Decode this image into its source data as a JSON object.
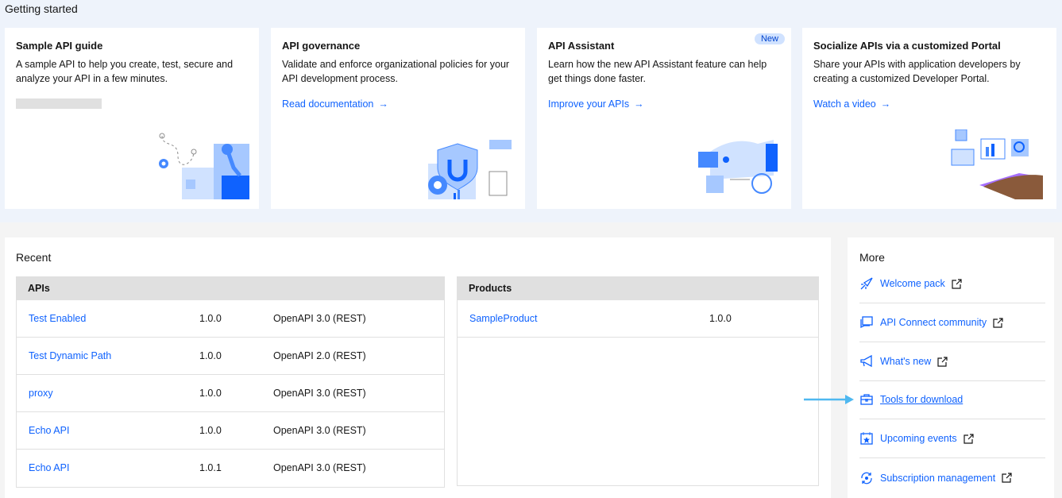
{
  "getting_started": {
    "title": "Getting started",
    "cards": [
      {
        "title": "Sample API guide",
        "description": "A sample API to help you create, test, secure and analyze your API in a few minutes."
      },
      {
        "title": "API governance",
        "description": "Validate and enforce organizational policies for your API development process.",
        "link": "Read documentation"
      },
      {
        "title": "API Assistant",
        "badge": "New",
        "description": "Learn how the new API Assistant feature can help get things done faster.",
        "link": "Improve your APIs"
      },
      {
        "title": "Socialize APIs via a customized Portal",
        "description": "Share your APIs with application developers by creating a customized Developer Portal.",
        "link": "Watch a video"
      }
    ]
  },
  "recent": {
    "title": "Recent",
    "apis": {
      "header": "APIs",
      "rows": [
        {
          "name": "Test Enabled",
          "version": "1.0.0",
          "type": "OpenAPI 3.0 (REST)"
        },
        {
          "name": "Test Dynamic Path",
          "version": "1.0.0",
          "type": "OpenAPI 2.0 (REST)"
        },
        {
          "name": "proxy",
          "version": "1.0.0",
          "type": "OpenAPI 3.0 (REST)"
        },
        {
          "name": "Echo API",
          "version": "1.0.0",
          "type": "OpenAPI 3.0 (REST)"
        },
        {
          "name": "Echo API",
          "version": "1.0.1",
          "type": "OpenAPI 3.0 (REST)"
        }
      ]
    },
    "products": {
      "header": "Products",
      "rows": [
        {
          "name": "SampleProduct",
          "version": "1.0.0"
        }
      ]
    }
  },
  "more": {
    "title": "More",
    "items": [
      {
        "label": "Welcome pack",
        "icon": "rocket-icon"
      },
      {
        "label": "API Connect community",
        "icon": "forum-icon"
      },
      {
        "label": "What's new",
        "icon": "bullhorn-icon"
      },
      {
        "label": "Tools for download",
        "icon": "toolbox-icon"
      },
      {
        "label": "Upcoming events",
        "icon": "event-icon"
      },
      {
        "label": "Subscription management",
        "icon": "subscription-icon"
      }
    ]
  },
  "colors": {
    "link": "#0f62fe",
    "annotation_arrow": "#4fb8f0"
  }
}
